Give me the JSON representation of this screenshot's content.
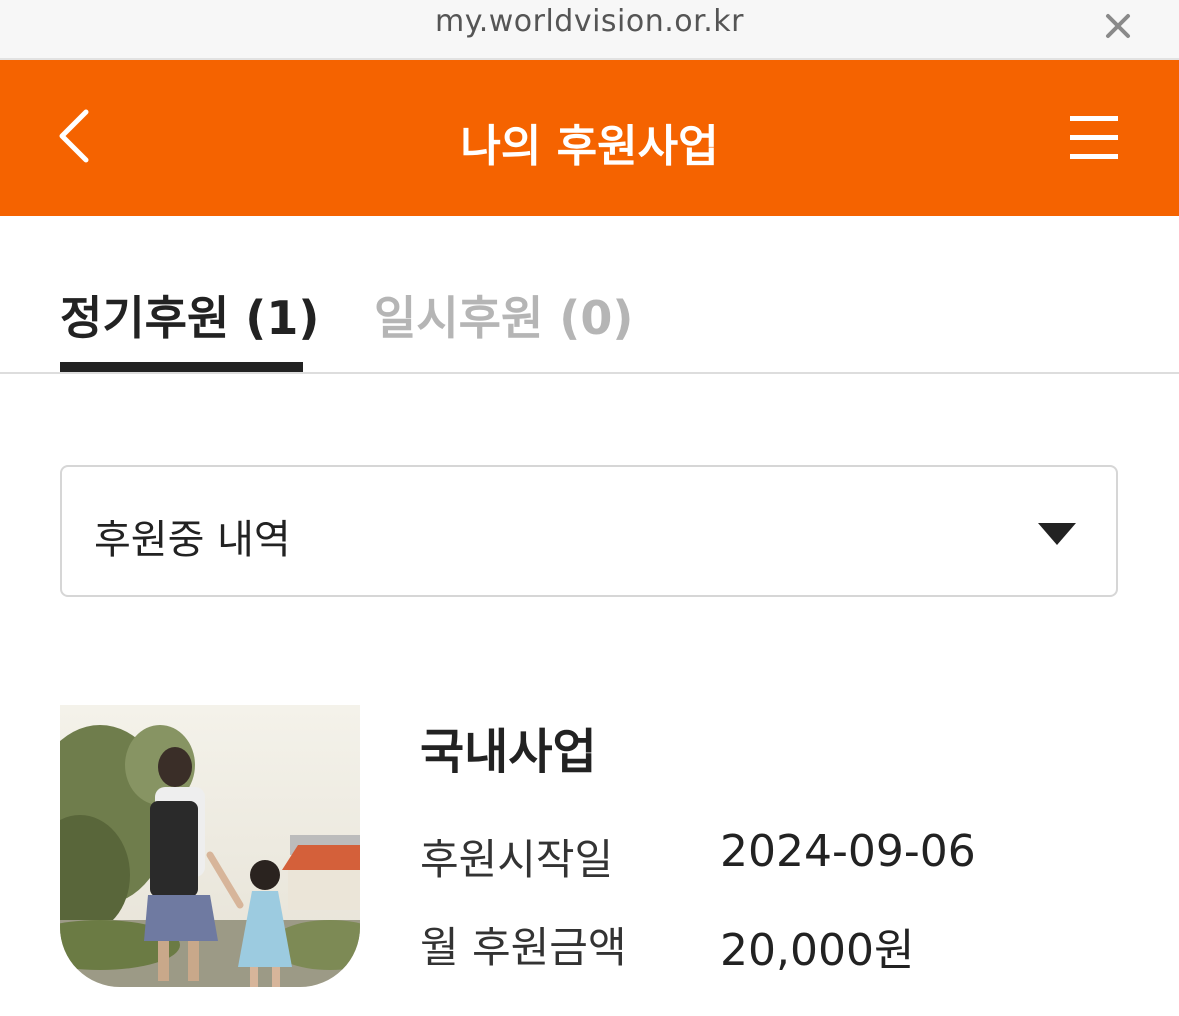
{
  "browser": {
    "url": "my.worldvision.or.kr",
    "close_icon": "close-icon"
  },
  "appbar": {
    "title": "나의 후원사업",
    "back_icon": "chevron-left-icon",
    "menu_icon": "hamburger-menu-icon",
    "color": "#f56300"
  },
  "tabs": [
    {
      "label": "정기후원 (1)",
      "active": true
    },
    {
      "label": "일시후원 (0)",
      "active": false
    }
  ],
  "filter": {
    "selected": "후원중 내역",
    "icon": "triangle-down-icon"
  },
  "project": {
    "name": "국내사업",
    "start_label": "후원시작일",
    "start_value": "2024-09-06",
    "amount_label": "월 후원금액",
    "amount_value": "20,000원"
  }
}
